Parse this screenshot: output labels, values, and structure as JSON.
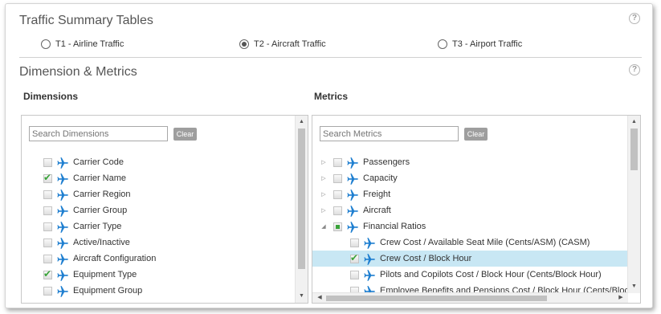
{
  "traffic": {
    "title": "Traffic Summary Tables",
    "options": [
      {
        "label": "T1 - Airline Traffic",
        "checked": false
      },
      {
        "label": "T2 - Aircraft Traffic",
        "checked": true
      },
      {
        "label": "T3 - Airport Traffic",
        "checked": false
      }
    ]
  },
  "dm": {
    "title": "Dimension & Metrics",
    "help_icon": "question-circle-icon"
  },
  "dimensions": {
    "title": "Dimensions",
    "search_placeholder": "Search Dimensions",
    "clear_label": "Clear",
    "items": [
      {
        "label": "Carrier Code",
        "checked": false
      },
      {
        "label": "Carrier Name",
        "checked": true
      },
      {
        "label": "Carrier Region",
        "checked": false
      },
      {
        "label": "Carrier Group",
        "checked": false
      },
      {
        "label": "Carrier Type",
        "checked": false
      },
      {
        "label": "Active/Inactive",
        "checked": false
      },
      {
        "label": "Aircraft Configuration",
        "checked": false
      },
      {
        "label": "Equipment Type",
        "checked": true
      },
      {
        "label": "Equipment Group",
        "checked": false
      }
    ]
  },
  "metrics": {
    "title": "Metrics",
    "search_placeholder": "Search Metrics",
    "clear_label": "Clear",
    "groups": [
      {
        "label": "Passengers",
        "expanded": false,
        "state": "none"
      },
      {
        "label": "Capacity",
        "expanded": false,
        "state": "none"
      },
      {
        "label": "Freight",
        "expanded": false,
        "state": "none"
      },
      {
        "label": "Aircraft",
        "expanded": false,
        "state": "none"
      },
      {
        "label": "Financial Ratios",
        "expanded": true,
        "state": "partial"
      }
    ],
    "children": [
      {
        "label": "Crew Cost / Available Seat Mile (Cents/ASM) (CASM)",
        "checked": false,
        "selected": false
      },
      {
        "label": "Crew Cost / Block Hour",
        "checked": true,
        "selected": true
      },
      {
        "label": "Pilots and Copilots Cost / Block Hour (Cents/Block Hour)",
        "checked": false,
        "selected": false
      },
      {
        "label": "Employee Benefits and Pensions Cost / Block Hour (Cents/Block Hour)",
        "checked": false,
        "selected": false
      }
    ]
  },
  "colors": {
    "plane": "#1f7fd0",
    "selected_row": "#c8e7f4",
    "check": "#3aa33a"
  }
}
